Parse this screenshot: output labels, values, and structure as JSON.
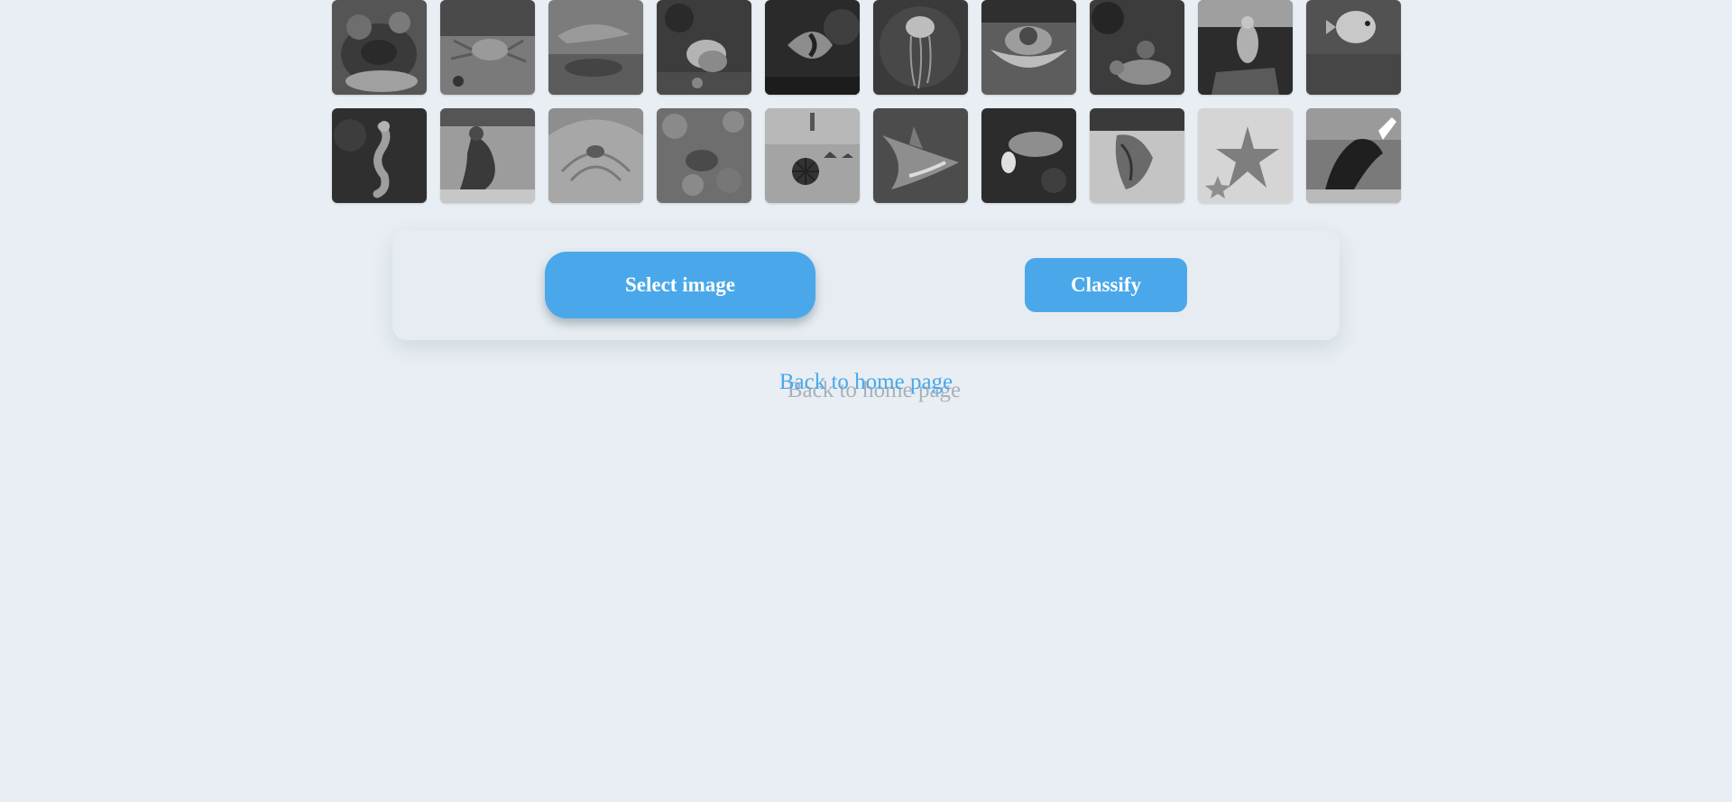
{
  "gallery": {
    "rows": [
      [
        {
          "icon": "coral-reef-icon"
        },
        {
          "icon": "crab-icon"
        },
        {
          "icon": "dolphin-icon"
        },
        {
          "icon": "sea-snail-icon"
        },
        {
          "icon": "angelfish-icon"
        },
        {
          "icon": "jellyfish-icon"
        },
        {
          "icon": "clam-icon"
        },
        {
          "icon": "crab-in-rocks-icon"
        },
        {
          "icon": "sea-bird-icon"
        },
        {
          "icon": "pufferfish-icon"
        }
      ],
      [
        {
          "icon": "seahorse-icon"
        },
        {
          "icon": "sea-lion-icon"
        },
        {
          "icon": "shell-icon"
        },
        {
          "icon": "sea-turtle-icon"
        },
        {
          "icon": "sea-urchin-on-beach-icon"
        },
        {
          "icon": "shark-icon"
        },
        {
          "icon": "lobster-icon"
        },
        {
          "icon": "cuttlefish-icon"
        },
        {
          "icon": "starfish-icon"
        },
        {
          "icon": "whale-icon"
        }
      ]
    ]
  },
  "actions": {
    "select_label": "Select image",
    "classify_label": "Classify"
  },
  "nav": {
    "home_label": "Back to home page"
  },
  "colors": {
    "accent": "#4aa8ea",
    "background": "#e8eef3"
  }
}
